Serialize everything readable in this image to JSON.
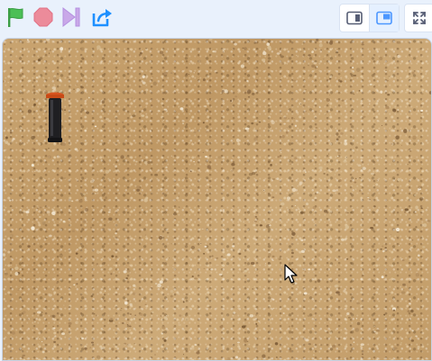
{
  "toolbar": {
    "green_flag_icon": "green-flag-icon",
    "stop_icon": "stop-sign-icon",
    "step_icon": "step-forward-icon",
    "share_icon": "share-icon",
    "colors": {
      "flag": "#4cbf56",
      "stop": "#ec8b9a",
      "step": "#c9a8e8",
      "share": "#1e90ff",
      "accent": "#4c97ff"
    },
    "stage_modes": [
      {
        "name": "small-stage",
        "icon": "small-stage-icon",
        "active": false
      },
      {
        "name": "large-stage",
        "icon": "large-stage-icon",
        "active": true
      }
    ],
    "fullscreen_icon": "fullscreen-icon"
  },
  "stage": {
    "backdrop": "gravel-ground",
    "backdrop_color": "#c8a16c",
    "sprites": [
      {
        "name": "sprinkler-sprite",
        "icon": "sprinkler-icon"
      }
    ]
  }
}
